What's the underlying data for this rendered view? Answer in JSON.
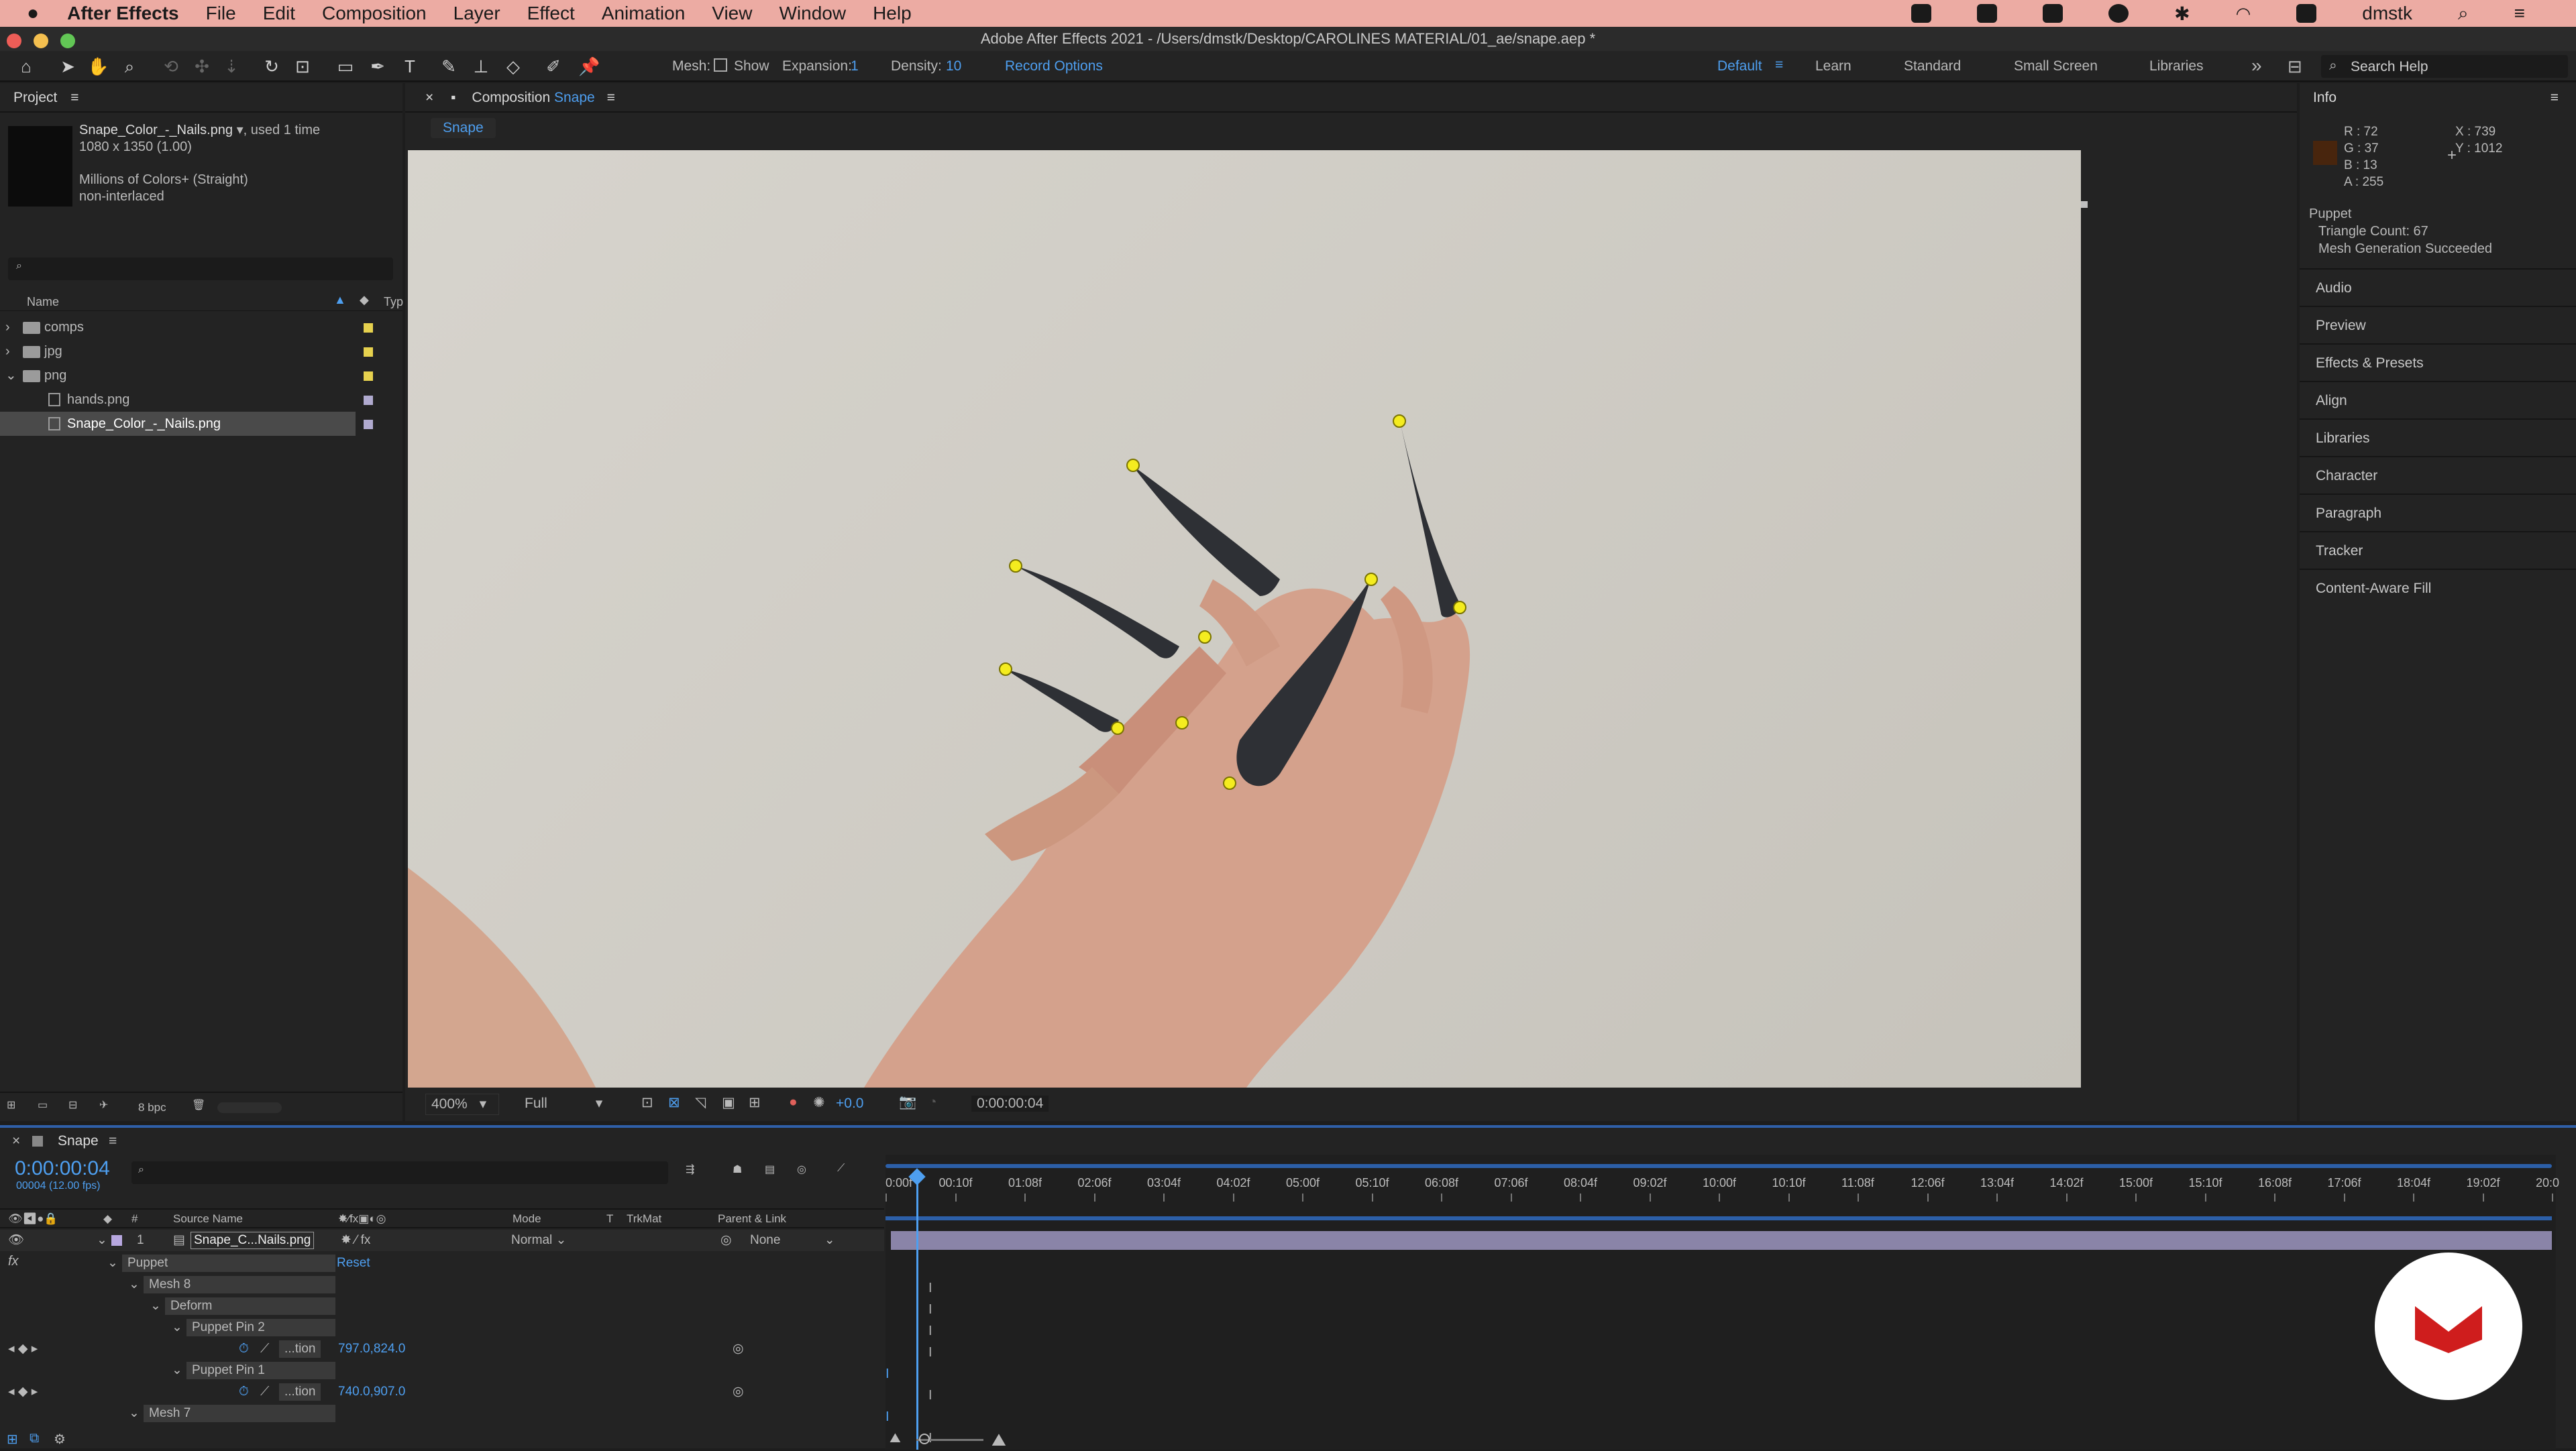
{
  "menubar": {
    "app": "After Effects",
    "items": [
      "File",
      "Edit",
      "Composition",
      "Layer",
      "Effect",
      "Animation",
      "View",
      "Window",
      "Help"
    ],
    "user": "dmstk"
  },
  "window_title": "Adobe After Effects 2021 - /Users/dmstk/Desktop/CAROLINES MATERIAL/01_ae/snape.aep *",
  "toolbar": {
    "mesh_label": "Mesh:",
    "show_label": "Show",
    "expansion_label": "Expansion:",
    "expansion_value": "1",
    "density_label": "Density:",
    "density_value": "10",
    "record_options": "Record Options",
    "workspaces": [
      "Default",
      "Learn",
      "Standard",
      "Small Screen",
      "Libraries"
    ],
    "search_placeholder": "Search Help"
  },
  "project": {
    "title": "Project",
    "file_name": "Snape_Color_-_Nails.png",
    "used": ", used 1 time",
    "dims": "1080 x 1350 (1.00)",
    "colors": "Millions of Colors+ (Straight)",
    "interlace": "non-interlaced",
    "col_name": "Name",
    "col_type": "Typ",
    "items": [
      {
        "name": "comps",
        "type": "folder",
        "open": false
      },
      {
        "name": "jpg",
        "type": "folder",
        "open": false
      },
      {
        "name": "png",
        "type": "folder",
        "open": true
      },
      {
        "name": "hands.png",
        "type": "file"
      },
      {
        "name": "Snape_Color_-_Nails.png",
        "type": "file",
        "selected": true
      }
    ],
    "bpc": "8 bpc"
  },
  "composition": {
    "tab_label": "Composition",
    "comp_name": "Snape",
    "sub_tab": "Snape",
    "zoom": "400%",
    "quality": "Full",
    "exposure": "+0.0",
    "timecode": "0:00:00:04"
  },
  "info": {
    "title": "Info",
    "r": "R : 72",
    "g": "G : 37",
    "b": "B : 13",
    "a": "A : 255",
    "x": "X : 739",
    "y": "Y : 1012",
    "swatch": "#48250d",
    "puppet_title": "Puppet",
    "triangles": "Triangle Count: 67",
    "mesh_status": "Mesh Generation Succeeded",
    "panels": [
      "Audio",
      "Preview",
      "Effects & Presets",
      "Align",
      "Libraries",
      "Character",
      "Paragraph",
      "Tracker",
      "Content-Aware Fill"
    ]
  },
  "timeline": {
    "tab": "Snape",
    "timecode": "0:00:00:04",
    "fps": "00004 (12.00 fps)",
    "headers": {
      "source": "Source Name",
      "mode": "Mode",
      "t": "T",
      "trkmat": "TrkMat",
      "parent": "Parent & Link",
      "num": "#"
    },
    "layer": {
      "num": "1",
      "name": "Snape_C...Nails.png",
      "mode": "Normal",
      "parent": "None"
    },
    "rows": [
      {
        "label": "Puppet",
        "indent": 1,
        "extra": "Reset"
      },
      {
        "label": "Mesh 8",
        "indent": 2
      },
      {
        "label": "Deform",
        "indent": 3
      },
      {
        "label": "Puppet Pin 2",
        "indent": 4
      },
      {
        "label": "...tion",
        "indent": 5,
        "value": "797.0,824.0"
      },
      {
        "label": "Puppet Pin 1",
        "indent": 4
      },
      {
        "label": "...tion",
        "indent": 5,
        "value": "740.0,907.0"
      },
      {
        "label": "Mesh 7",
        "indent": 2
      }
    ],
    "ruler": [
      "0:00f",
      "00:10f",
      "01:08f",
      "02:06f",
      "03:04f",
      "04:02f",
      "05:00f",
      "05:10f",
      "06:08f",
      "07:06f",
      "08:04f",
      "09:02f",
      "10:00f",
      "10:10f",
      "11:08f",
      "12:06f",
      "13:04f",
      "14:02f",
      "15:00f",
      "15:10f",
      "16:08f",
      "17:06f",
      "18:04f",
      "19:02f",
      "20:0"
    ]
  },
  "colors": {
    "accent": "#4e9ff0",
    "pin": "#f4ec1f",
    "bg_wall": "#ccc8c0",
    "skin": "#d9a490",
    "nail": "#2f3136",
    "logo": "#cf1d1d"
  }
}
